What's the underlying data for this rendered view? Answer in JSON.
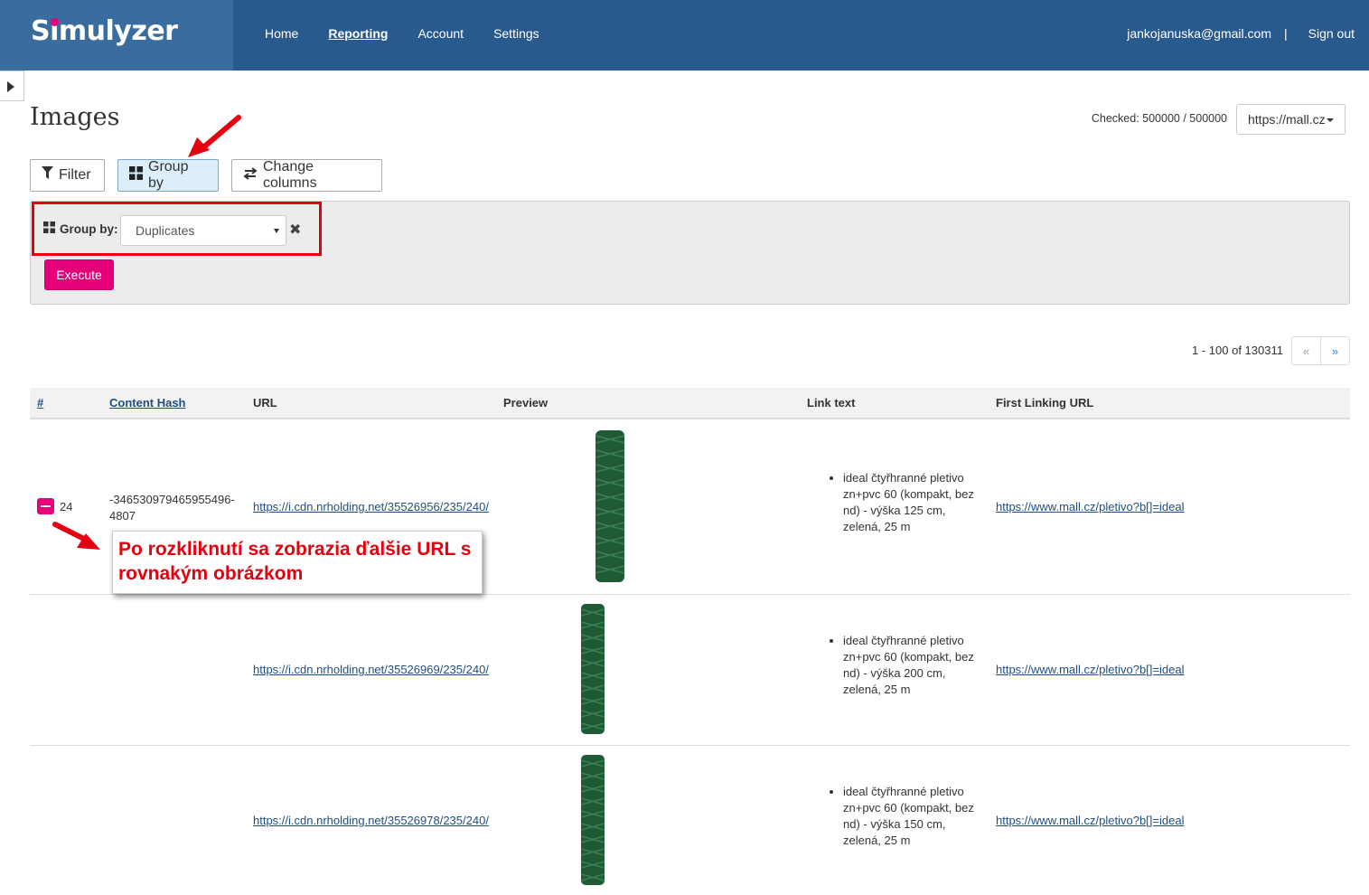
{
  "brand": {
    "name_prefix": "S",
    "name_dot_letter": "i",
    "name_suffix": "mulyzer"
  },
  "nav": [
    {
      "label": "Home",
      "active": false
    },
    {
      "label": "Reporting",
      "active": true
    },
    {
      "label": "Account",
      "active": false
    },
    {
      "label": "Settings",
      "active": false
    }
  ],
  "user": {
    "email": "jankojanuska@gmail.com",
    "separator": "|",
    "sign_out": "Sign out"
  },
  "page": {
    "title": "Images"
  },
  "status": {
    "checked_label": "Checked:",
    "checked_value": "500000 / 500000"
  },
  "site_select": {
    "value": "https://mall.cz"
  },
  "toolbar": {
    "filter": "Filter",
    "group_by": "Group by",
    "change_columns": "Change columns"
  },
  "group_panel": {
    "label": "Group by:",
    "selected": "Duplicates",
    "execute": "Execute"
  },
  "pagination": {
    "info": "1 - 100 of 130311",
    "prev": "«",
    "next": "»"
  },
  "table": {
    "columns": {
      "num": "#",
      "hash": "Content Hash",
      "url": "URL",
      "preview": "Preview",
      "link_text": "Link text",
      "first_linking_url": "First Linking URL"
    },
    "rows": [
      {
        "count": "24",
        "hash": "-346530979465955496-4807",
        "url": "https://i.cdn.nrholding.net/35526956/235/240/",
        "link_text": "ideal čtyřhranné pletivo zn+pvc 60 (kompakt, bez nd) - výška 125 cm, zelená, 25 m",
        "first_linking_url": "https://www.mall.cz/pletivo?b[]=ideal"
      },
      {
        "count": "",
        "hash": "",
        "url": "https://i.cdn.nrholding.net/35526969/235/240/",
        "link_text": "ideal čtyřhranné pletivo zn+pvc 60 (kompakt, bez nd) - výška 200 cm, zelená, 25 m",
        "first_linking_url": "https://www.mall.cz/pletivo?b[]=ideal"
      },
      {
        "count": "",
        "hash": "",
        "url": "https://i.cdn.nrholding.net/35526978/235/240/",
        "link_text": "ideal čtyřhranné pletivo zn+pvc 60 (kompakt, bez nd) - výška 150 cm, zelená, 25 m",
        "first_linking_url": "https://www.mall.cz/pletivo?b[]=ideal"
      }
    ]
  },
  "annotation": {
    "callout_text": "Po rozkliknutí sa zobrazia ďalšie URL s rovnakým obrázkom"
  },
  "colors": {
    "header": "#285a8e",
    "brand_bg": "#3b6c9e",
    "accent": "#e5007a",
    "annotation_red": "#e5000f"
  }
}
